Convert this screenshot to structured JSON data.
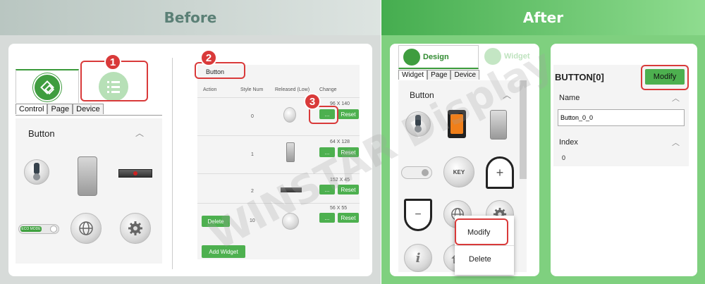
{
  "before": {
    "header": "Before",
    "tabs": [
      "Control",
      "Page",
      "Device"
    ],
    "section_title": "Button",
    "badges": [
      "1",
      "2",
      "3"
    ],
    "button_tab_label": "Button",
    "table_headers": [
      "Action",
      "Style Num",
      "Released (Low)",
      "Change"
    ],
    "rows": [
      {
        "style_num": "0",
        "size": "96 X 140",
        "btn": "...",
        "reset": "Reset"
      },
      {
        "style_num": "1",
        "size": "64 X 128",
        "btn": "...",
        "reset": "Reset"
      },
      {
        "style_num": "2",
        "size": "152 X 45",
        "btn": "...",
        "reset": "Reset"
      },
      {
        "style_num": "10",
        "size": "56 X 55",
        "btn": "...",
        "reset": "Reset",
        "action": "Delete"
      }
    ],
    "add_widget": "Add Widget",
    "eco_label": "ECO MODE"
  },
  "after": {
    "header": "After",
    "design_label": "Design",
    "widget_label": "Widget",
    "tabs": [
      "Widget",
      "Page",
      "Device"
    ],
    "section_title": "Button",
    "key_label": "KEY",
    "context_menu": [
      "Modify",
      "Delete"
    ],
    "props_title": "BUTTON[0]",
    "modify_button": "Modify",
    "name_label": "Name",
    "name_value": "Button_0_0",
    "index_label": "Index",
    "index_value": "0"
  },
  "watermark": "WINSTAR Display"
}
